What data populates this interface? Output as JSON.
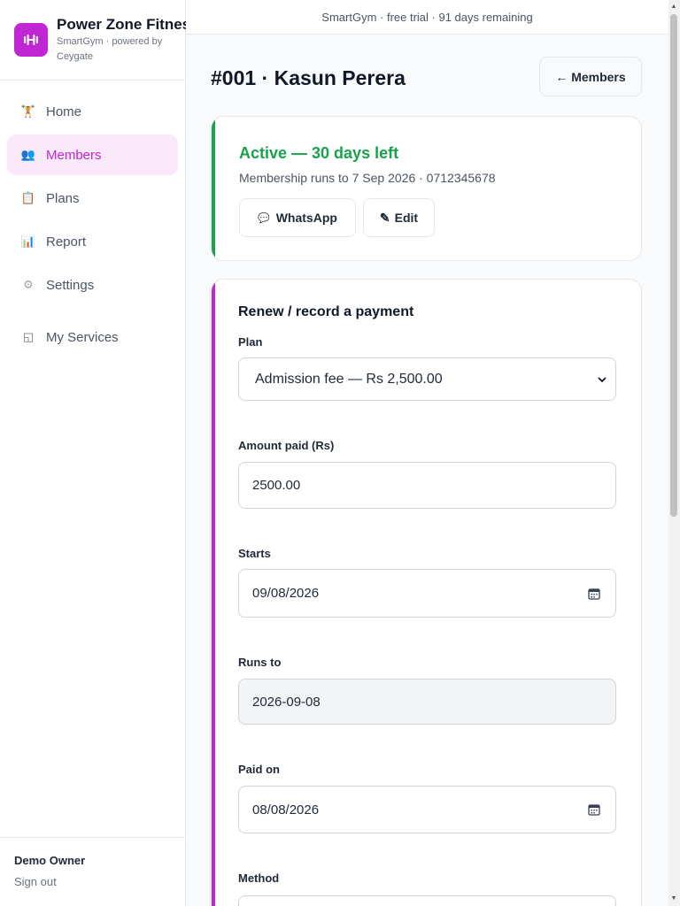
{
  "sidebar": {
    "brand_name": "Power Zone Fitness",
    "brand_sub": "SmartGym · powered by Ceygate",
    "items": [
      {
        "label": "Home",
        "icon": "🏋"
      },
      {
        "label": "Members",
        "icon": "👥"
      },
      {
        "label": "Plans",
        "icon": "📋"
      },
      {
        "label": "Report",
        "icon": "📊"
      },
      {
        "label": "Settings",
        "icon": "⚙"
      },
      {
        "label": "My Services",
        "icon": "◱"
      }
    ],
    "owner": "Demo Owner",
    "signout": "Sign out"
  },
  "banner": "SmartGym · free trial · 91 days remaining",
  "page": {
    "title": "#001 · Kasun Perera",
    "back_label": "← Members"
  },
  "status": {
    "title": "Active — 30 days left",
    "subtitle": "Membership runs to 7 Sep 2026 · 0712345678",
    "whatsapp_label": "WhatsApp",
    "whatsapp_icon": "💬",
    "edit_label": "Edit",
    "edit_icon": "✎",
    "accent": "#16a34a"
  },
  "payment": {
    "title": "Renew / record a payment",
    "plan_label": "Plan",
    "plan_value": "Admission fee — Rs 2,500.00",
    "amount_label": "Amount paid (Rs)",
    "amount_value": "2500.00",
    "starts_label": "Starts",
    "starts_value": "09/08/2026",
    "runs_label": "Runs to",
    "runs_value": "2026-09-08",
    "paid_label": "Paid on",
    "paid_value": "08/08/2026",
    "method_label": "Method",
    "accent": "#c026d3"
  }
}
